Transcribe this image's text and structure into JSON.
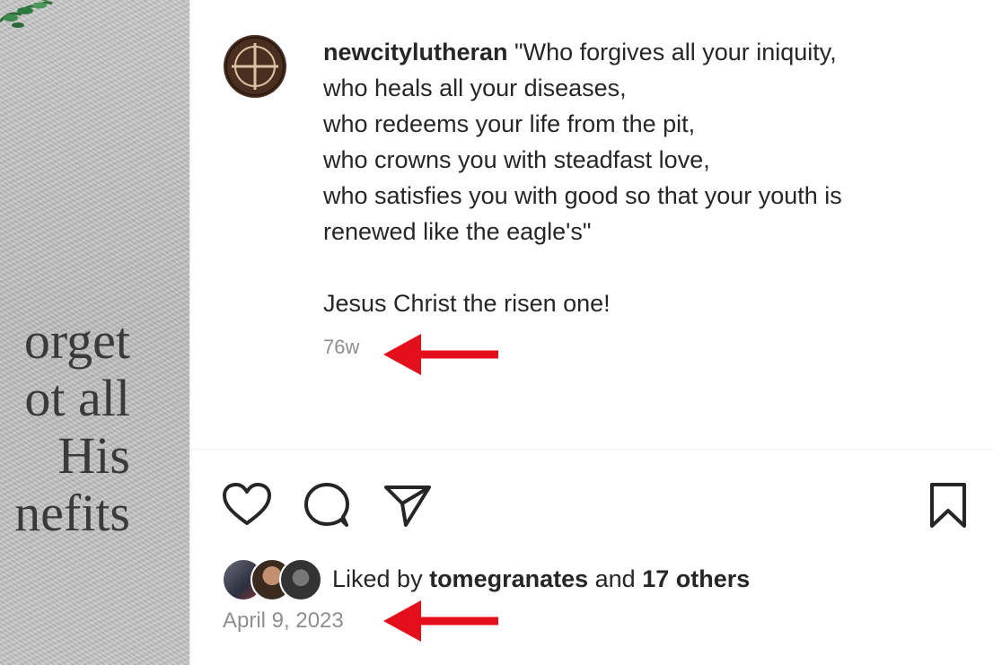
{
  "image_panel": {
    "verse_lines": [
      "orget",
      "ot all",
      "His",
      "nefits"
    ]
  },
  "post": {
    "username": "newcitylutheran",
    "caption_lines": [
      " \"Who forgives all your iniquity,",
      "who heals all your diseases,",
      "who redeems your life from the pit,",
      "who crowns you with steadfast love,",
      "who satisfies you with good so that your youth is",
      "renewed like the eagle's\""
    ],
    "caption_footer": "Jesus Christ the risen one!",
    "age": "76w",
    "liked_by_prefix": "Liked by ",
    "liked_by_user": "tomegranates",
    "liked_by_middle": " and ",
    "liked_by_others": "17 others",
    "date": "April 9, 2023"
  },
  "icons": {
    "avatar": "cross-medallion-icon",
    "like": "heart-icon",
    "comment": "comment-bubble-icon",
    "share": "paper-plane-icon",
    "save": "bookmark-icon",
    "annotation": "red-arrow-icon"
  },
  "colors": {
    "annotation_arrow": "#e3101b",
    "secondary_text": "#8e8e8e",
    "primary_text": "#262626"
  }
}
